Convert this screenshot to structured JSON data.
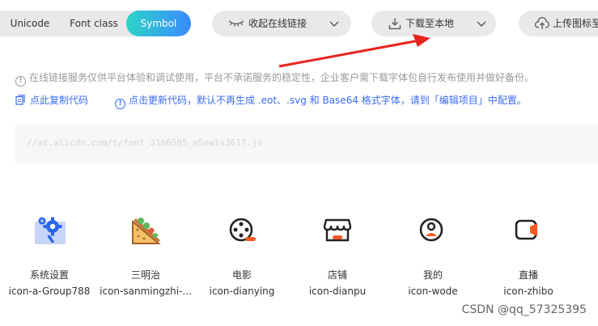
{
  "tabs": [
    {
      "label": "Unicode"
    },
    {
      "label": "Font class"
    },
    {
      "label": "Symbol",
      "active": true
    }
  ],
  "toolbar": {
    "collapse_label": "收起在线链接",
    "download_label": "下载至本地",
    "upload_label": "上传图标至"
  },
  "notices": {
    "disclaimer": "在线链接服务仅供平台体验和调试使用，平台不承诺服务的稳定性，企业客户需下载字体包自行发布使用并做好备份。",
    "copy_code": "点此复制代码",
    "update_code": "点击更新代码，默认不再生成 .eot、.svg 和 Base64 格式字体，请到「编辑项目」中配置。"
  },
  "code_link": "//at.alicdn.com/t/font_3166595_e5ew1s3617.js",
  "icons": [
    {
      "name": "系统设置",
      "code": "icon-a-Group788",
      "glyph": "settings-icon"
    },
    {
      "name": "三明治",
      "code": "icon-sanmingzhi-...",
      "glyph": "sandwich-icon"
    },
    {
      "name": "电影",
      "code": "icon-dianying",
      "glyph": "film-reel-icon"
    },
    {
      "name": "店铺",
      "code": "icon-dianpu",
      "glyph": "shop-icon"
    },
    {
      "name": "我的",
      "code": "icon-wode",
      "glyph": "user-icon"
    },
    {
      "name": "直播",
      "code": "icon-zhibo",
      "glyph": "live-icon"
    }
  ],
  "colors": {
    "accent_start": "#2ed4c7",
    "accent_end": "#3a8bff",
    "link_blue": "#3a6cf4",
    "icon_orange": "#f05a22",
    "arrow_red": "#e8231e"
  },
  "watermark": "CSDN @qq_57325395"
}
